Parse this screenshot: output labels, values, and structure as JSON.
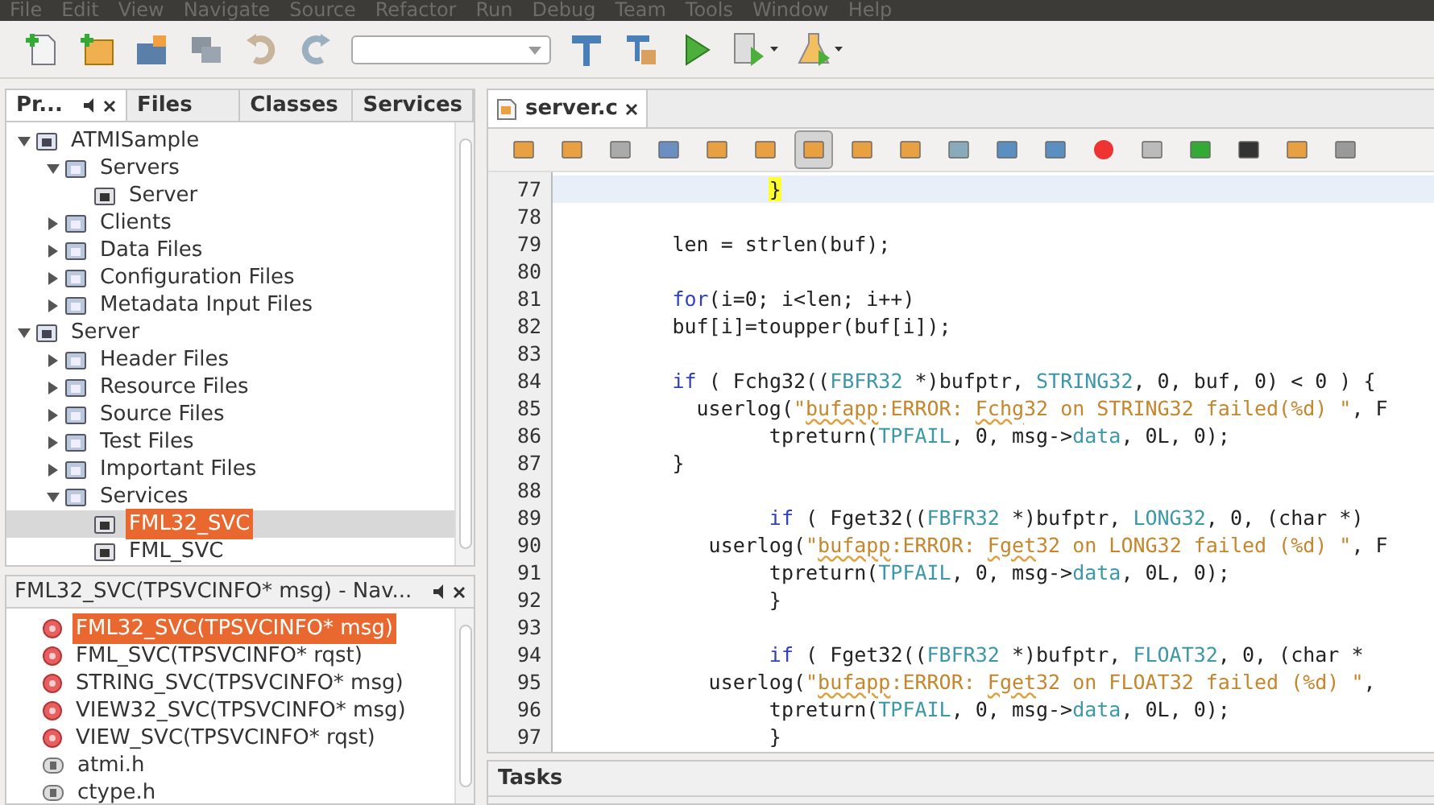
{
  "menu_bar": [
    "File",
    "Edit",
    "View",
    "Navigate",
    "Source",
    "Refactor",
    "Run",
    "Debug",
    "Team",
    "Tools",
    "Window",
    "Help"
  ],
  "projects_panel": {
    "tabs": [
      {
        "label": "Pr...",
        "selected": true
      },
      {
        "label": "Files",
        "selected": false
      },
      {
        "label": "Classes",
        "selected": false
      },
      {
        "label": "Services",
        "selected": false
      }
    ],
    "tree": [
      {
        "label": "ATMISample",
        "expanded": true,
        "selected": false,
        "children": [
          {
            "label": "Servers",
            "expanded": true,
            "selected": false,
            "children": [
              {
                "label": "Server",
                "selected": false
              }
            ]
          },
          {
            "label": "Clients",
            "expanded": false,
            "selected": false
          },
          {
            "label": "Data Files",
            "expanded": false,
            "selected": false
          },
          {
            "label": "Configuration Files",
            "expanded": false,
            "selected": false
          },
          {
            "label": "Metadata Input Files",
            "expanded": false,
            "selected": false
          }
        ]
      },
      {
        "label": "Server",
        "expanded": true,
        "selected": false,
        "children": [
          {
            "label": "Header Files",
            "expanded": false,
            "selected": false
          },
          {
            "label": "Resource Files",
            "expanded": false,
            "selected": false
          },
          {
            "label": "Source Files",
            "expanded": false,
            "selected": false
          },
          {
            "label": "Test Files",
            "expanded": false,
            "selected": false
          },
          {
            "label": "Important Files",
            "expanded": false,
            "selected": false
          },
          {
            "label": "Services",
            "expanded": true,
            "selected": false,
            "children": [
              {
                "label": "FML32_SVC",
                "selected": true
              },
              {
                "label": "FML_SVC",
                "selected": false
              }
            ]
          }
        ]
      }
    ]
  },
  "navigator_panel": {
    "title": "FML32_SVC(TPSVCINFO* msg) - Nav...",
    "items": [
      {
        "kind": "function",
        "label": "FML32_SVC(TPSVCINFO* msg)",
        "selected": true
      },
      {
        "kind": "function",
        "label": "FML_SVC(TPSVCINFO* rqst)",
        "selected": false
      },
      {
        "kind": "function",
        "label": "STRING_SVC(TPSVCINFO* msg)",
        "selected": false
      },
      {
        "kind": "function",
        "label": "VIEW32_SVC(TPSVCINFO* msg)",
        "selected": false
      },
      {
        "kind": "function",
        "label": "VIEW_SVC(TPSVCINFO* rqst)",
        "selected": false
      },
      {
        "kind": "header",
        "label": "atmi.h",
        "selected": false
      },
      {
        "kind": "header",
        "label": "ctype.h",
        "selected": false
      }
    ]
  },
  "editor": {
    "tabs": [
      {
        "label": "server.c",
        "selected": true
      }
    ],
    "toolbar_buttons": [
      {
        "pressed": false
      },
      {
        "pressed": false
      },
      {
        "pressed": false
      },
      {
        "pressed": false
      },
      {
        "pressed": false
      },
      {
        "pressed": false
      },
      {
        "pressed": true
      },
      {
        "pressed": false
      },
      {
        "pressed": false
      },
      {
        "pressed": false
      },
      {
        "pressed": false
      },
      {
        "pressed": false
      },
      {
        "pressed": false
      },
      {
        "pressed": false
      },
      {
        "pressed": false
      },
      {
        "pressed": false
      },
      {
        "pressed": false
      },
      {
        "pressed": false
      }
    ],
    "lines": [
      {
        "number": "77",
        "current": true,
        "tokens": [
          {
            "kind": "match",
            "text": "                }"
          }
        ]
      },
      {
        "number": "78",
        "current": false
      },
      {
        "number": "79",
        "current": false,
        "tokens": [
          {
            "kind": "plain",
            "text": "        len = strlen(buf);"
          }
        ]
      },
      {
        "number": "80",
        "current": false
      },
      {
        "number": "81",
        "current": false,
        "tokens": [
          {
            "kind": "keyword",
            "text": "        for"
          },
          {
            "kind": "plain",
            "text": "(i=0; i<len; i++)"
          }
        ]
      },
      {
        "number": "82",
        "current": false,
        "tokens": [
          {
            "kind": "plain",
            "text": "        buf[i]=toupper(buf[i]);"
          }
        ]
      },
      {
        "number": "83",
        "current": false
      },
      {
        "number": "84",
        "current": false,
        "tokens": [
          {
            "kind": "keyword",
            "text": "        if"
          },
          {
            "kind": "plain",
            "text": " ( Fchg32(("
          },
          {
            "kind": "constant",
            "text": "FBFR32"
          },
          {
            "kind": "plain",
            "text": " *)bufptr, "
          },
          {
            "kind": "constant",
            "text": "STRING32"
          },
          {
            "kind": "plain",
            "text": ", 0, buf, 0) < 0 ) {"
          }
        ]
      },
      {
        "number": "85",
        "current": false,
        "tokens": [
          {
            "kind": "plain",
            "text": "          userlog("
          },
          {
            "kind": "string",
            "text": "\""
          },
          {
            "kind": "flagged",
            "text": "bufapp"
          },
          {
            "kind": "string",
            "text": ":ERROR: "
          },
          {
            "kind": "flagged",
            "text": "Fchg"
          },
          {
            "kind": "string",
            "text": "32 on STRING32 failed(%d) \""
          },
          {
            "kind": "plain",
            "text": ", F"
          }
        ]
      },
      {
        "number": "86",
        "current": false,
        "tokens": [
          {
            "kind": "plain",
            "text": "                tpreturn("
          },
          {
            "kind": "constant",
            "text": "TPFAIL"
          },
          {
            "kind": "plain",
            "text": ", 0, msg->"
          },
          {
            "kind": "constant",
            "text": "data"
          },
          {
            "kind": "plain",
            "text": ", 0L, 0);"
          }
        ]
      },
      {
        "number": "87",
        "current": false,
        "tokens": [
          {
            "kind": "plain",
            "text": "        }"
          }
        ]
      },
      {
        "number": "88",
        "current": false
      },
      {
        "number": "89",
        "current": false,
        "tokens": [
          {
            "kind": "keyword",
            "text": "                if"
          },
          {
            "kind": "plain",
            "text": " ( Fget32(("
          },
          {
            "kind": "constant",
            "text": "FBFR32"
          },
          {
            "kind": "plain",
            "text": " *)bufptr, "
          },
          {
            "kind": "constant",
            "text": "LONG32"
          },
          {
            "kind": "plain",
            "text": ", 0, (char *)"
          }
        ]
      },
      {
        "number": "90",
        "current": false,
        "tokens": [
          {
            "kind": "plain",
            "text": "           userlog("
          },
          {
            "kind": "string",
            "text": "\""
          },
          {
            "kind": "flagged",
            "text": "bufapp"
          },
          {
            "kind": "string",
            "text": ":ERROR: "
          },
          {
            "kind": "flagged",
            "text": "Fget"
          },
          {
            "kind": "string",
            "text": "32 on LONG32 failed (%d) \""
          },
          {
            "kind": "plain",
            "text": ", F"
          }
        ]
      },
      {
        "number": "91",
        "current": false,
        "tokens": [
          {
            "kind": "plain",
            "text": "                tpreturn("
          },
          {
            "kind": "constant",
            "text": "TPFAIL"
          },
          {
            "kind": "plain",
            "text": ", 0, msg->"
          },
          {
            "kind": "constant",
            "text": "data"
          },
          {
            "kind": "plain",
            "text": ", 0L, 0);"
          }
        ]
      },
      {
        "number": "92",
        "current": false,
        "tokens": [
          {
            "kind": "plain",
            "text": "                }"
          }
        ]
      },
      {
        "number": "93",
        "current": false
      },
      {
        "number": "94",
        "current": false,
        "tokens": [
          {
            "kind": "keyword",
            "text": "                if"
          },
          {
            "kind": "plain",
            "text": " ( Fget32(("
          },
          {
            "kind": "constant",
            "text": "FBFR32"
          },
          {
            "kind": "plain",
            "text": " *)bufptr, "
          },
          {
            "kind": "constant",
            "text": "FLOAT32"
          },
          {
            "kind": "plain",
            "text": ", 0, (char *"
          }
        ]
      },
      {
        "number": "95",
        "current": false,
        "tokens": [
          {
            "kind": "plain",
            "text": "           userlog("
          },
          {
            "kind": "string",
            "text": "\""
          },
          {
            "kind": "flagged",
            "text": "bufapp"
          },
          {
            "kind": "string",
            "text": ":ERROR: "
          },
          {
            "kind": "flagged",
            "text": "Fget"
          },
          {
            "kind": "string",
            "text": "32 on FLOAT32 failed (%d) \""
          },
          {
            "kind": "plain",
            "text": ","
          }
        ]
      },
      {
        "number": "96",
        "current": false,
        "tokens": [
          {
            "kind": "plain",
            "text": "                tpreturn("
          },
          {
            "kind": "constant",
            "text": "TPFAIL"
          },
          {
            "kind": "plain",
            "text": ", 0, msg->"
          },
          {
            "kind": "constant",
            "text": "data"
          },
          {
            "kind": "plain",
            "text": ", 0L, 0);"
          }
        ]
      },
      {
        "number": "97",
        "current": false,
        "tokens": [
          {
            "kind": "plain",
            "text": "                }"
          }
        ]
      }
    ]
  },
  "tasks_panel": {
    "title": "Tasks"
  }
}
